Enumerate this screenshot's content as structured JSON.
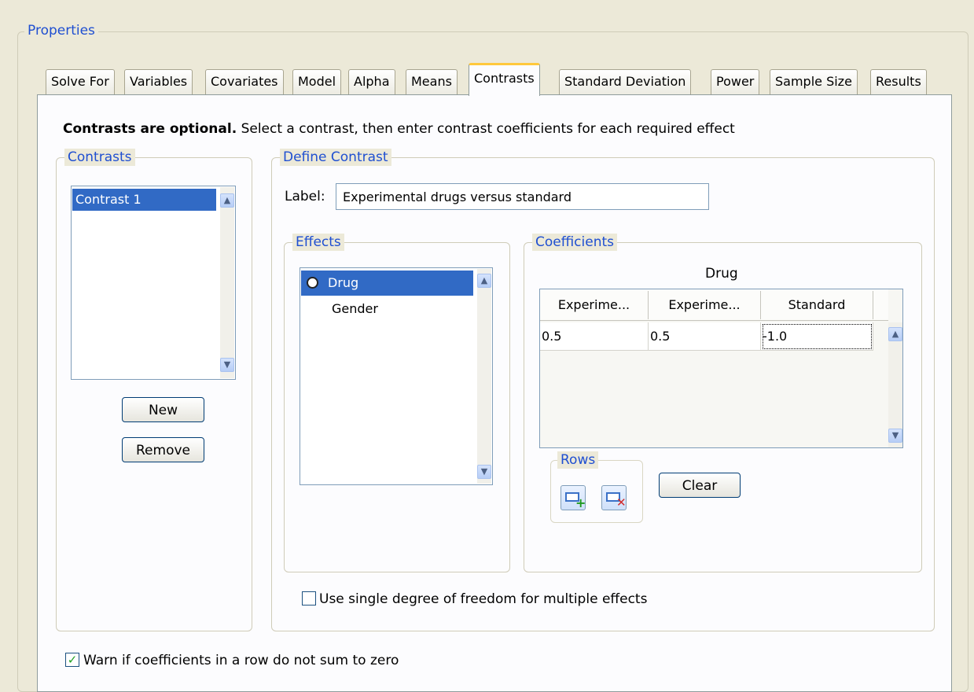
{
  "properties_label": "Properties",
  "tabs": [
    {
      "label": "Solve For"
    },
    {
      "label": "Variables"
    },
    {
      "label": "Covariates"
    },
    {
      "label": "Model"
    },
    {
      "label": "Alpha"
    },
    {
      "label": "Means"
    },
    {
      "label": "Contrasts",
      "active": true
    },
    {
      "label": "Standard Deviation"
    },
    {
      "label": "Power"
    },
    {
      "label": "Sample Size"
    },
    {
      "label": "Results"
    }
  ],
  "instruction": {
    "bold": "Contrasts are optional.",
    "rest": " Select a contrast, then enter contrast coefficients for each required effect"
  },
  "contrasts": {
    "title": "Contrasts",
    "items": [
      "Contrast 1"
    ],
    "new_label": "New",
    "remove_label": "Remove"
  },
  "define": {
    "title": "Define Contrast",
    "label_caption": "Label:",
    "label_value": "Experimental drugs versus standard"
  },
  "effects": {
    "title": "Effects",
    "items": [
      "Drug",
      "Gender"
    ]
  },
  "coefficients": {
    "title": "Coefficients",
    "group_header": "Drug",
    "columns": [
      "Experime...",
      "Experime...",
      "Standard"
    ],
    "rows": [
      [
        "0.5",
        "0.5",
        "-1.0"
      ]
    ],
    "rows_title": "Rows",
    "clear_label": "Clear"
  },
  "single_df": {
    "label": "Use single degree of freedom for multiple effects",
    "checked": false
  },
  "warn": {
    "label": "Warn if coefficients in a row do not sum to zero",
    "checked": true
  }
}
